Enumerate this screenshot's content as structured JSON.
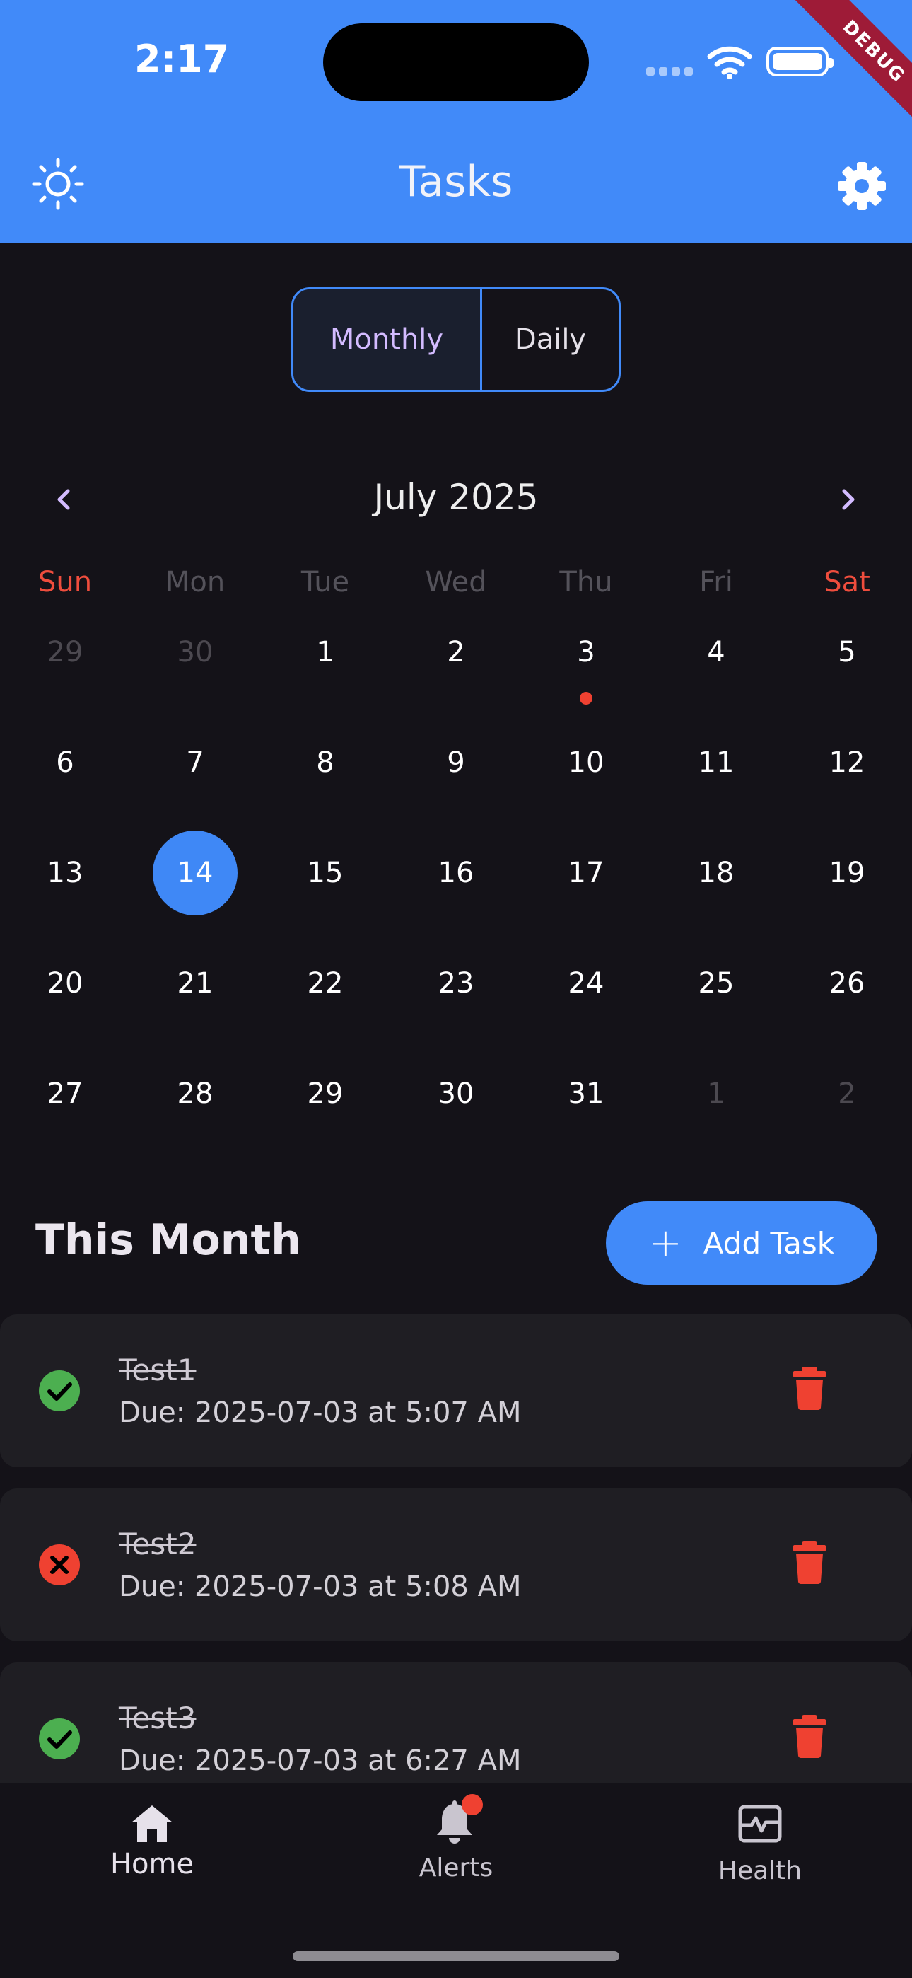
{
  "status_bar": {
    "time": "2:17",
    "debug_banner": "DEBUG"
  },
  "app_bar": {
    "title": "Tasks",
    "theme_icon": "sun-icon",
    "settings_icon": "gear-icon"
  },
  "view_toggle": {
    "monthly": "Monthly",
    "daily": "Daily",
    "selected": "Monthly"
  },
  "calendar": {
    "month_label": "July 2025",
    "weekdays": [
      "Sun",
      "Mon",
      "Tue",
      "Wed",
      "Thu",
      "Fri",
      "Sat"
    ],
    "weeks": [
      [
        "29",
        "30",
        "1",
        "2",
        "3",
        "4",
        "5"
      ],
      [
        "6",
        "7",
        "8",
        "9",
        "10",
        "11",
        "12"
      ],
      [
        "13",
        "14",
        "15",
        "16",
        "17",
        "18",
        "19"
      ],
      [
        "20",
        "21",
        "22",
        "23",
        "24",
        "25",
        "26"
      ],
      [
        "27",
        "28",
        "29",
        "30",
        "31",
        "1",
        "2"
      ]
    ],
    "selected_day": "14",
    "days_with_tasks": [
      "3"
    ],
    "colors": {
      "weekend": "#ef4d3d",
      "selected": "#3f88f6",
      "task_dot": "#ef4131"
    }
  },
  "section": {
    "title": "This Month",
    "add_button": "Add Task"
  },
  "tasks": [
    {
      "name": "Test1",
      "due": "Due: 2025-07-03 at 5:07 AM",
      "status": "done",
      "status_icon": "check-circle-icon"
    },
    {
      "name": "Test2",
      "due": "Due: 2025-07-03 at 5:08 AM",
      "status": "missed",
      "status_icon": "x-circle-icon"
    },
    {
      "name": "Test3",
      "due": "Due: 2025-07-03 at 6:27 AM",
      "status": "done",
      "status_icon": "check-circle-icon"
    }
  ],
  "bottom_nav": {
    "items": [
      {
        "label": "Home",
        "icon": "home-icon",
        "active": true
      },
      {
        "label": "Alerts",
        "icon": "bell-icon",
        "badge": true
      },
      {
        "label": "Health",
        "icon": "health-icon"
      }
    ]
  },
  "theme": {
    "primary": "#418af9",
    "background": "#141218",
    "card": "#1f1e23",
    "danger": "#ef4131",
    "success": "#4caf50"
  }
}
